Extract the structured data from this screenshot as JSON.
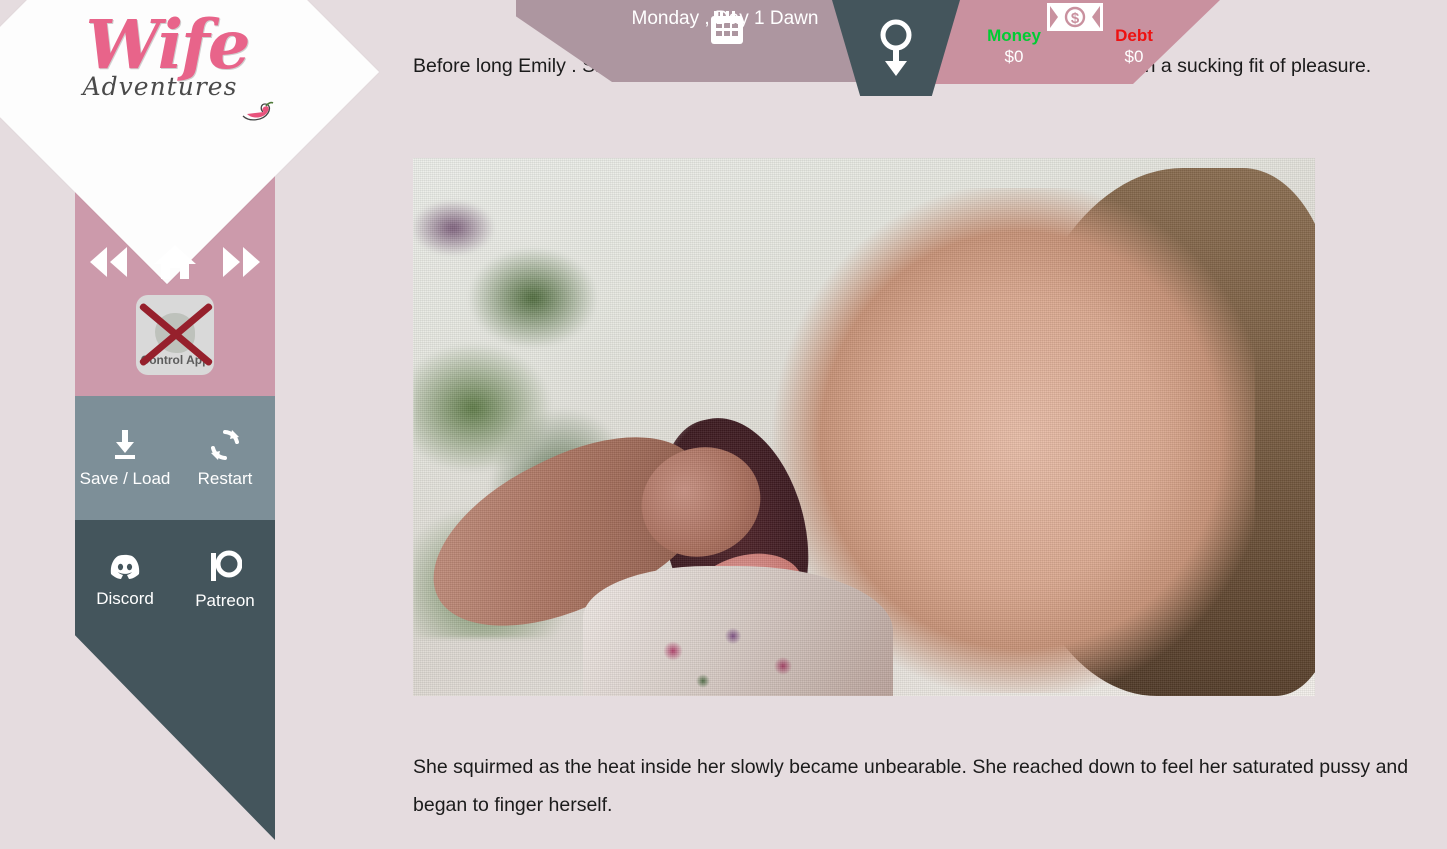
{
  "app": {
    "logo_word": "Wife",
    "logo_sub": "Adventures",
    "logo_chili_icon": "chili-pepper-icon"
  },
  "sidebar": {
    "nav": [
      {
        "name": "rewind",
        "icon": "rewind-icon",
        "label": ""
      },
      {
        "name": "home",
        "icon": "home-icon",
        "label": ""
      },
      {
        "name": "forward",
        "icon": "fast-forward-icon",
        "label": ""
      }
    ],
    "control_app": {
      "label": "Control App",
      "disabled": true,
      "icon": "control-app-icon",
      "overlay_icon": "red-x-icon"
    },
    "menu": [
      {
        "label": "Save / Load",
        "icon": "download-icon"
      },
      {
        "label": "Restart",
        "icon": "refresh-icon"
      },
      {
        "label": "Discord",
        "icon": "discord-icon"
      },
      {
        "label": "Patreon",
        "icon": "patreon-icon"
      }
    ],
    "colors": {
      "pink": "#cc9aab",
      "gray": "#7d8f98",
      "dark": "#44555c"
    }
  },
  "hud": {
    "date_icon": "calendar-icon",
    "date_text": "Monday , Day 1 Dawn",
    "gender_icon": "female-arrow-icon",
    "money_icon": "banknote-icon",
    "money_label": "Money",
    "money_value": "$0",
    "debt_label": "Debt",
    "debt_value": "$0",
    "colors": {
      "money": "#00cc33",
      "debt": "#ee1111",
      "left_band": "#ad96a0",
      "right_band": "#c9919f",
      "center_band": "#44555c"
    }
  },
  "story": {
    "paragraph_top": "Before long Emily                                            . She gasped for air when she needed to but otherwise was stuck in a sucking fit of pleasure.",
    "paragraph_bottom": "She squirmed as the heat inside her slowly became unbearable. She reached down to feel her saturated pussy and began to finger herself."
  },
  "scene": {
    "alt": "scene-image"
  },
  "page": {
    "background": "#e5dcdf"
  }
}
